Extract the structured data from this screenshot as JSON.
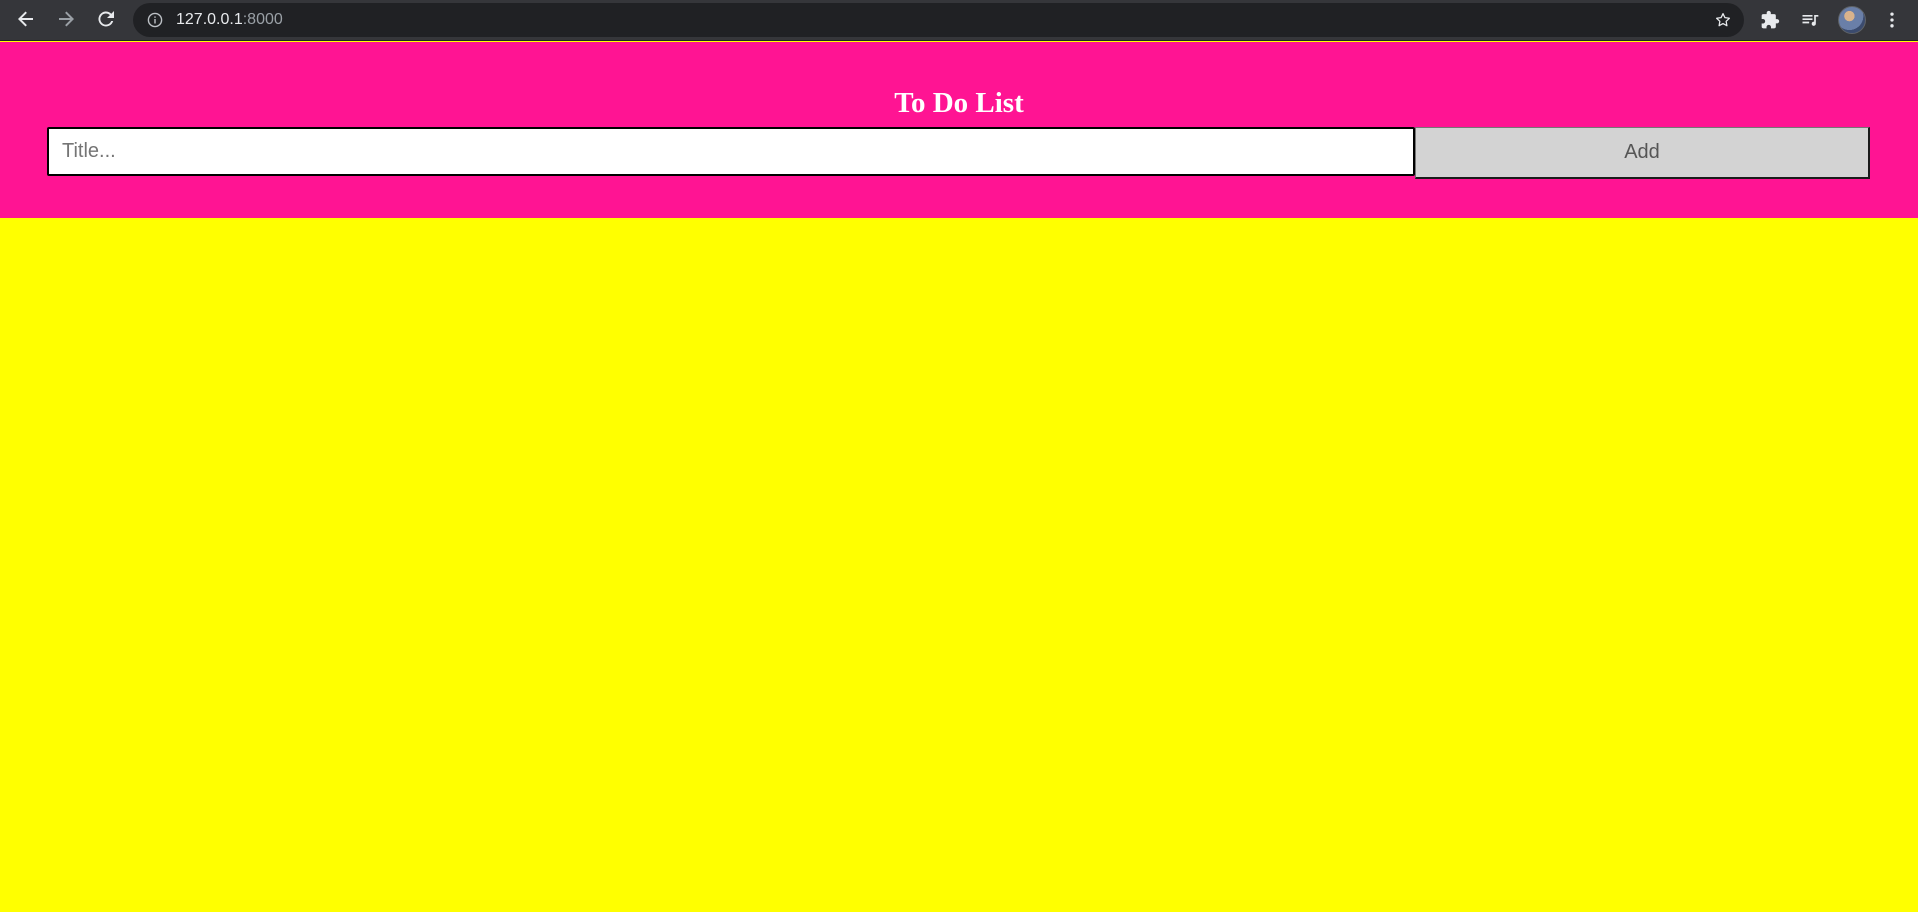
{
  "browser": {
    "url_host": "127.0.0.1",
    "url_port": ":8000"
  },
  "header": {
    "title": "To Do List"
  },
  "form": {
    "title_placeholder": "Title...",
    "title_value": "",
    "add_label": "Add"
  },
  "colors": {
    "header_background": "#ff1493",
    "page_background": "#ffff00",
    "button_background": "#d3d3d3"
  },
  "icons": [
    "back-arrow-icon",
    "forward-arrow-icon",
    "reload-icon",
    "info-icon",
    "star-icon",
    "extensions-icon",
    "media-playlist-icon",
    "more-vert-icon"
  ]
}
